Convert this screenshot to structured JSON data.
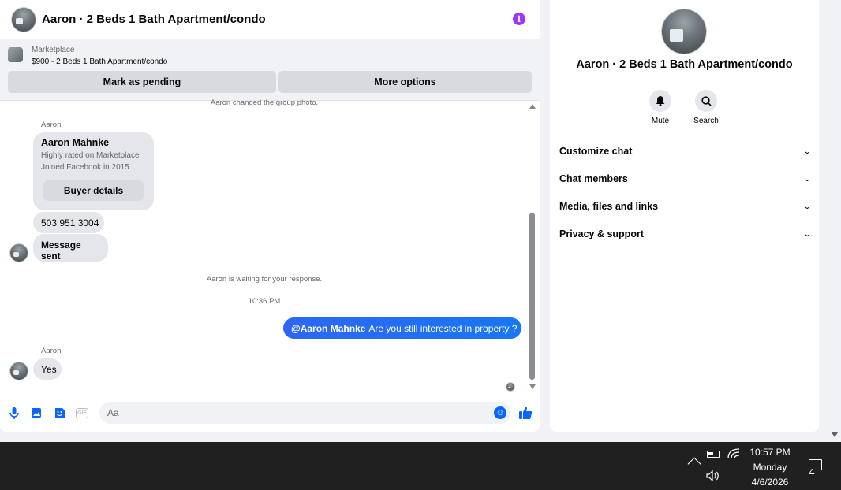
{
  "header": {
    "title": "Aaron · 2 Beds 1 Bath Apartment/condo",
    "info_icon": "info-icon"
  },
  "marketplace": {
    "label": "Marketplace",
    "listing": "$900 - 2 Beds 1 Bath Apartment/condo",
    "mark_pending_label": "Mark as pending",
    "more_options_label": "More options"
  },
  "messages": {
    "system_photo": "Aaron changed the group photo.",
    "sender_1": "Aaron",
    "card": {
      "name": "Aaron Mahnke",
      "rating": "Highly rated on Marketplace",
      "joined": "Joined Facebook in 2015",
      "button": "Buyer details"
    },
    "phone": "503 951 3004",
    "sent_text": "Message sent",
    "waiting": "Aaron is waiting for your response.",
    "timestamp": "10:36 PM",
    "my_mention": "@Aaron Mahnke",
    "my_text": "Are you still interested in property ?",
    "sender_2": "Aaron",
    "reply": "Yes"
  },
  "composer": {
    "placeholder": "Aa",
    "value": "",
    "gif_label": "GIF"
  },
  "panel": {
    "title": "Aaron · 2 Beds 1 Bath Apartment/condo",
    "mute_label": "Mute",
    "search_label": "Search",
    "sections": [
      "Customize chat",
      "Chat members",
      "Media, files and links",
      "Privacy & support"
    ]
  },
  "taskbar": {
    "time": "10:57 PM",
    "day": "Monday",
    "date": "4/6/2026"
  },
  "colors": {
    "accent": "#0866ff",
    "info": "#a033ff",
    "my_bubble": "#1877f2",
    "taskbar": "#202020"
  }
}
